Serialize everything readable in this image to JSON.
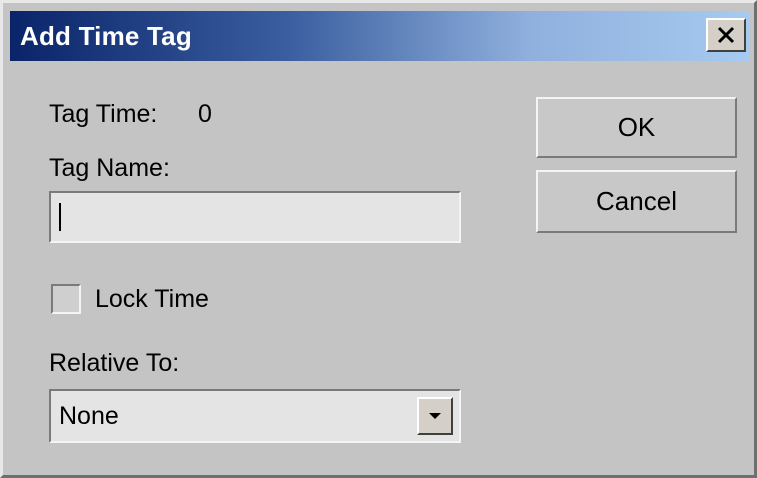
{
  "dialog": {
    "title": "Add Time Tag",
    "close_icon": "close-icon"
  },
  "form": {
    "tag_time_label": "Tag Time:",
    "tag_time_value": "0",
    "tag_name_label": "Tag Name:",
    "tag_name_value": "",
    "lock_time_label": "Lock Time",
    "lock_time_checked": false,
    "relative_to_label": "Relative To:",
    "relative_to_value": "None"
  },
  "buttons": {
    "ok_label": "OK",
    "cancel_label": "Cancel"
  },
  "colors": {
    "title_gradient_start": "#0a246a",
    "title_gradient_end": "#a6caf0",
    "dialog_face": "#c4c4c4"
  }
}
